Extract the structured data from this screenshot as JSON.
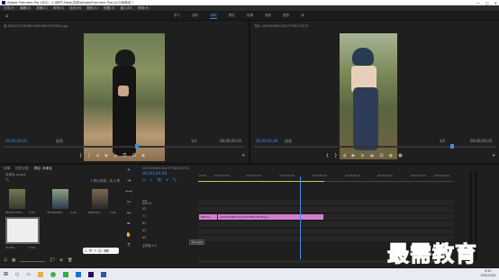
{
  "window": {
    "title": "Adobe Premiere Pro 2020 - C:\\用户\\Ydsq\\文档\\Adobe\\Premiere Pro\\14.0\\未命名 *"
  },
  "menu": [
    "文件(F)",
    "编辑(E)",
    "剪辑(C)",
    "序列(S)",
    "标记(M)",
    "图形(G)",
    "视图(V)",
    "窗口(W)",
    "帮助(H)"
  ],
  "workspace": {
    "tabs": [
      "学习",
      "组件",
      "编辑",
      "颜色",
      "效果",
      "音频",
      "图形",
      "库"
    ],
    "active": "编辑"
  },
  "source": {
    "title": "源: 8ED2C7493F5B01AFB1D8F3F0C9802.jpg",
    "timecode": "00;00;00;01",
    "fit": "适合",
    "zoom": "1/2",
    "duration": "00;00;05;01"
  },
  "program": {
    "title": "节目: 4633D59B9C30A7F7F8E1C5E78",
    "timecode": "00;00;04;06",
    "fit": "适合",
    "zoom": "1/2",
    "duration": "00;00;05;03"
  },
  "project": {
    "tabs": [
      "效果",
      "历史记录",
      "项目: 未命名"
    ],
    "file": "未命名.prproj",
    "count": "1 项已选择，共 4 项",
    "items": [
      {
        "name": "8ED2C7493...",
        "dur": "5;00"
      },
      {
        "name": "4633D59B...",
        "dur": "5;00"
      },
      {
        "name": "B6B7C8...",
        "dur": "5;00"
      },
      {
        "name": "4633D...",
        "dur": "5;00"
      }
    ]
  },
  "timeline": {
    "title": "4633D59B9C30A7F7F8E1C5E78",
    "timecode": "00;00;04;06",
    "ruler": [
      ";00;00",
      ";00;00;01;00",
      "00;00;02;00",
      "00;00;03;00",
      "00;00;04;00",
      "00;00;05;00",
      "00;00;06;00",
      "00;00;07;00",
      "00;00;08;00",
      "00;00;09;00"
    ],
    "tracks": [
      "V3",
      "V2",
      "V1",
      "A1",
      "A2",
      "A3",
      "主声道"
    ],
    "clip1": "8ED2C...",
    "clip2": "4633D59B9C30A7F7F8E1C5E78.jpg",
    "tooltip": "滚动/缩放",
    "master_val": "0.0"
  },
  "taskbar": {
    "time": "9:25",
    "date": "2021/1/29"
  },
  "watermark": "最需教育"
}
